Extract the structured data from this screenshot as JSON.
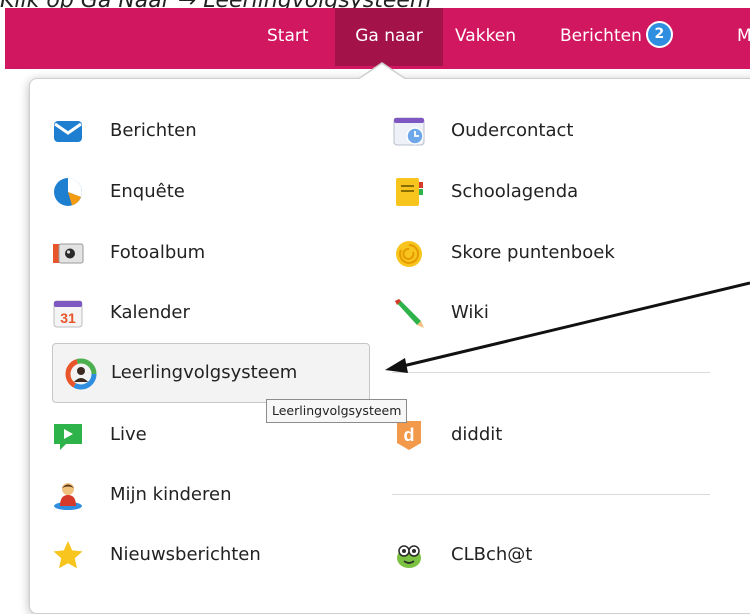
{
  "caption": "Klik op Ga Naar → Leerlingvolgsysteem",
  "colors": {
    "brand": "#d1175f",
    "active_tab": "#a4124a",
    "badge": "#2f8ee0"
  },
  "nav": {
    "start": "Start",
    "ga_naar": "Ga naar",
    "vakken": "Vakken",
    "berichten": "Berichten",
    "berichten_badge": "2",
    "more": "Me"
  },
  "menu": {
    "left": [
      {
        "label": "Berichten",
        "icon": "envelope-icon"
      },
      {
        "label": "Enquête",
        "icon": "pie-chart-icon"
      },
      {
        "label": "Fotoalbum",
        "icon": "camera-icon"
      },
      {
        "label": "Kalender",
        "icon": "calendar-icon",
        "icon_text": "31"
      },
      {
        "label": "Leerlingvolgsysteem",
        "icon": "student-tracking-icon",
        "selected": true
      },
      {
        "label": "Live",
        "icon": "live-play-icon"
      },
      {
        "label": "Mijn kinderen",
        "icon": "child-icon"
      },
      {
        "label": "Nieuwsberichten",
        "icon": "star-icon"
      }
    ],
    "right": [
      {
        "label": "Oudercontact",
        "icon": "calendar-clock-icon"
      },
      {
        "label": "Schoolagenda",
        "icon": "agenda-book-icon"
      },
      {
        "label": "Skore puntenboek",
        "icon": "snail-shell-icon"
      },
      {
        "label": "Wiki",
        "icon": "pencil-icon"
      },
      {
        "label": "diddit",
        "icon": "diddit-icon",
        "icon_text": "d"
      },
      {
        "label": "CLBch@t",
        "icon": "clbchat-mascot-icon"
      }
    ]
  },
  "tooltip": "Leerlingvolgsysteem"
}
